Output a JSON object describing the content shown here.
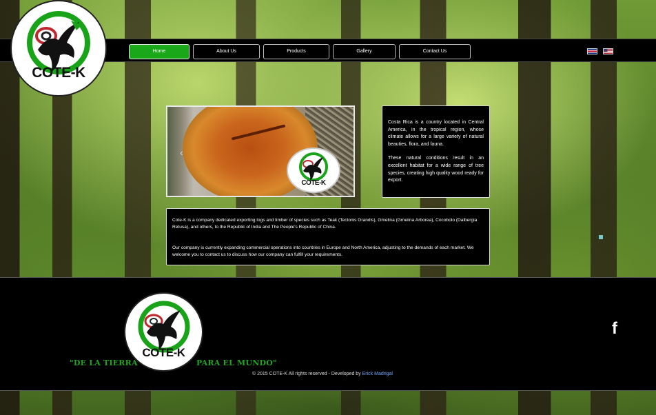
{
  "brand": {
    "name": "COTE-K"
  },
  "nav": {
    "items": [
      {
        "label": "Home"
      },
      {
        "label": "About Us"
      },
      {
        "label": "Products"
      },
      {
        "label": "Gallery"
      },
      {
        "label": "Contact Us"
      }
    ]
  },
  "languages": {
    "cr": "costa-rica-flag-icon",
    "us": "us-flag-icon"
  },
  "intro": {
    "p1": "Costa Rica is a country located in Central America, in the tropical region, whose climate allows for a large variety of natural beauties, flora, and fauna.",
    "p2": "These natural conditions result in an excellent habitat for a wide range of tree species, creating high quality wood ready for export."
  },
  "about": {
    "p1": "Cote-K is a company dedicated exporting logs and timber of species such as Teak (Tectonis Grandis), Gmelina (Gmeiina Arborea), Cocobolo (Dalbergia Retusa), and others, to the Republic of India and The People's Republic of China.",
    "p2": "Our company is currently expanding commercial operations into countries in Europe and North America, adjusting to the demands of each market. We welcome you to contact us to discuss how our company can fulfill your requirements."
  },
  "footer": {
    "motto_left": "\"DE LA TIERRA",
    "motto_right": "PARA EL MUNDO\"",
    "copyright": "© 2015 COTE-K All rights reserved - Developed by",
    "developer": "Erick Madrigal",
    "social": "f"
  },
  "colors": {
    "accent": "#1aa81a",
    "nav_bg": "#000000",
    "motto": "#22a322"
  }
}
